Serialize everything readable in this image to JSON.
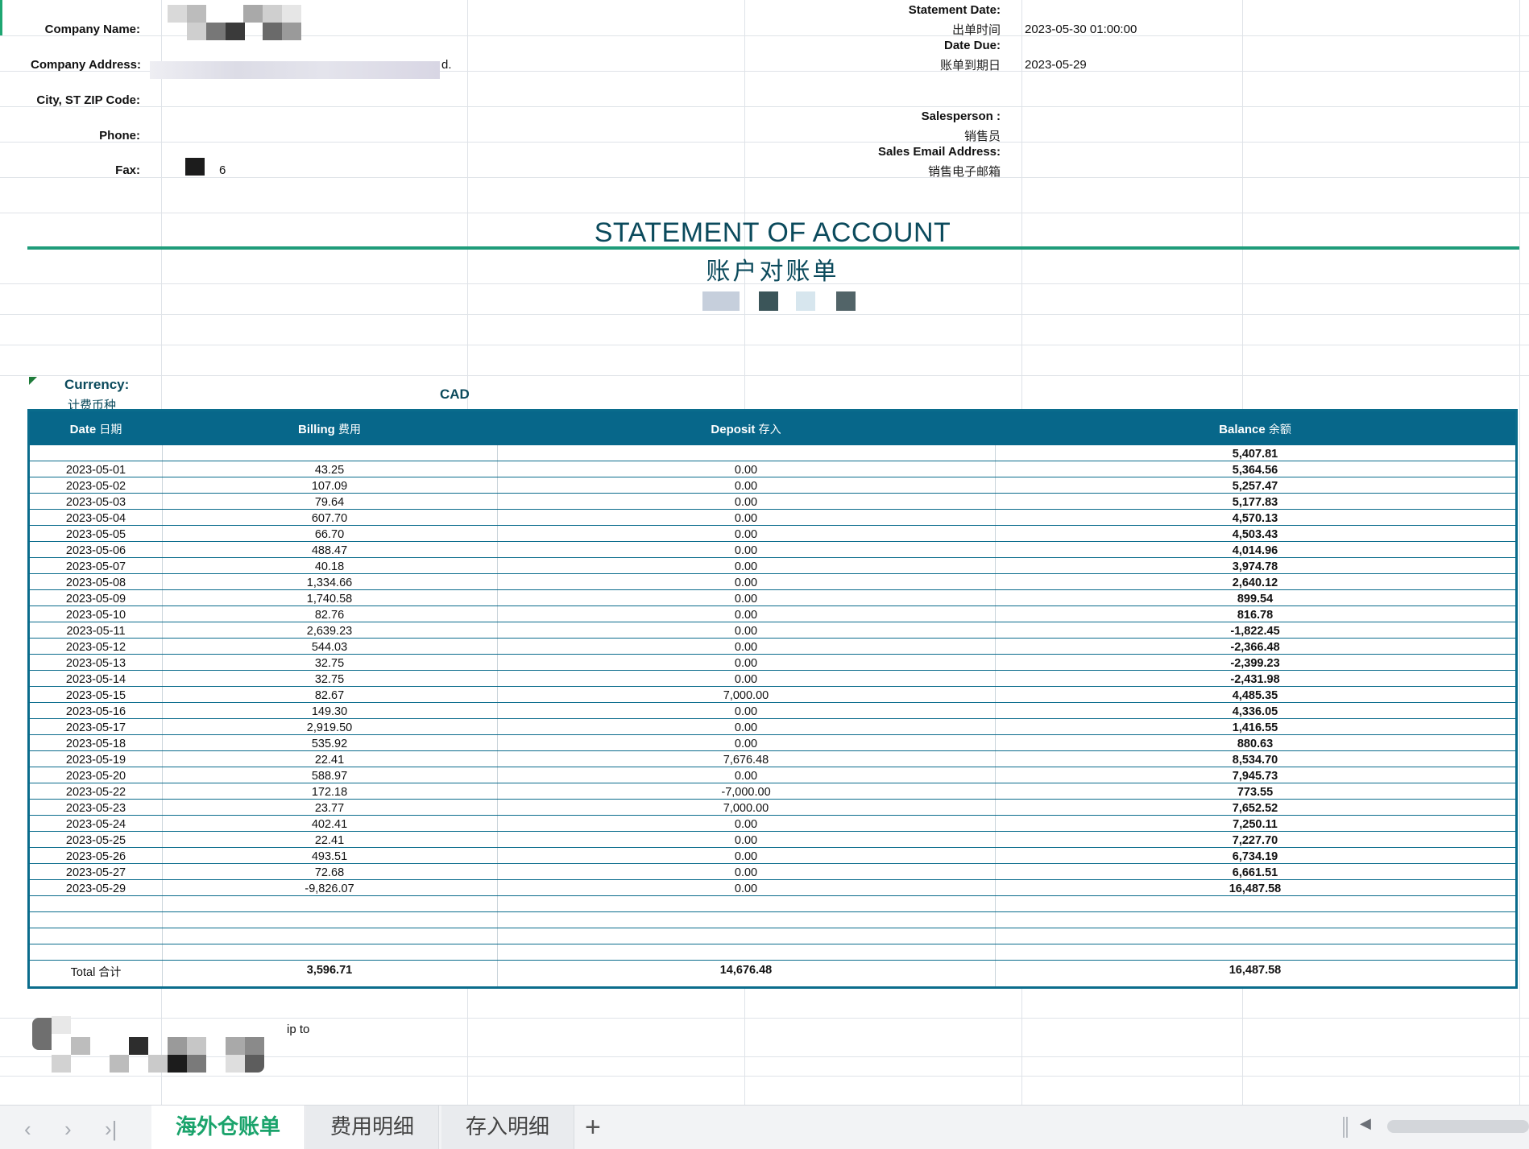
{
  "header_left": {
    "company_name_label": "Company Name:",
    "company_address_label": "Company Address:",
    "company_address_tail": "d.",
    "city_label": "City, ST  ZIP Code:",
    "phone_label": "Phone:",
    "fax_label": "Fax:",
    "fax_tail": "6"
  },
  "header_right": {
    "statement_date_label": "Statement Date:",
    "statement_date_cn": "出单时间",
    "statement_date_value": "2023-05-30 01:00:00",
    "date_due_label": "Date Due:",
    "date_due_cn": "账单到期日",
    "date_due_value": "2023-05-29",
    "salesperson_label": "Salesperson :",
    "salesperson_cn": "销售员",
    "sales_email_label": "Sales Email Address:",
    "sales_email_cn": "销售电子邮箱"
  },
  "title": {
    "en": "STATEMENT OF ACCOUNT",
    "cn": "账户对账单"
  },
  "currency": {
    "label": "Currency:",
    "cn": "计费币种",
    "value": "CAD"
  },
  "table": {
    "headers": {
      "date": "Date",
      "date_cn": "日期",
      "billing": "Billing",
      "billing_cn": "费用",
      "deposit": "Deposit",
      "deposit_cn": "存入",
      "balance": "Balance",
      "balance_cn": "余额"
    },
    "opening_balance": "5,407.81",
    "rows": [
      {
        "date": "2023-05-01",
        "billing": "43.25",
        "deposit": "0.00",
        "balance": "5,364.56"
      },
      {
        "date": "2023-05-02",
        "billing": "107.09",
        "deposit": "0.00",
        "balance": "5,257.47"
      },
      {
        "date": "2023-05-03",
        "billing": "79.64",
        "deposit": "0.00",
        "balance": "5,177.83"
      },
      {
        "date": "2023-05-04",
        "billing": "607.70",
        "deposit": "0.00",
        "balance": "4,570.13"
      },
      {
        "date": "2023-05-05",
        "billing": "66.70",
        "deposit": "0.00",
        "balance": "4,503.43"
      },
      {
        "date": "2023-05-06",
        "billing": "488.47",
        "deposit": "0.00",
        "balance": "4,014.96"
      },
      {
        "date": "2023-05-07",
        "billing": "40.18",
        "deposit": "0.00",
        "balance": "3,974.78"
      },
      {
        "date": "2023-05-08",
        "billing": "1,334.66",
        "deposit": "0.00",
        "balance": "2,640.12"
      },
      {
        "date": "2023-05-09",
        "billing": "1,740.58",
        "deposit": "0.00",
        "balance": "899.54"
      },
      {
        "date": "2023-05-10",
        "billing": "82.76",
        "deposit": "0.00",
        "balance": "816.78"
      },
      {
        "date": "2023-05-11",
        "billing": "2,639.23",
        "deposit": "0.00",
        "balance": "-1,822.45"
      },
      {
        "date": "2023-05-12",
        "billing": "544.03",
        "deposit": "0.00",
        "balance": "-2,366.48"
      },
      {
        "date": "2023-05-13",
        "billing": "32.75",
        "deposit": "0.00",
        "balance": "-2,399.23"
      },
      {
        "date": "2023-05-14",
        "billing": "32.75",
        "deposit": "0.00",
        "balance": "-2,431.98"
      },
      {
        "date": "2023-05-15",
        "billing": "82.67",
        "deposit": "7,000.00",
        "balance": "4,485.35"
      },
      {
        "date": "2023-05-16",
        "billing": "149.30",
        "deposit": "0.00",
        "balance": "4,336.05"
      },
      {
        "date": "2023-05-17",
        "billing": "2,919.50",
        "deposit": "0.00",
        "balance": "1,416.55"
      },
      {
        "date": "2023-05-18",
        "billing": "535.92",
        "deposit": "0.00",
        "balance": "880.63"
      },
      {
        "date": "2023-05-19",
        "billing": "22.41",
        "deposit": "7,676.48",
        "balance": "8,534.70"
      },
      {
        "date": "2023-05-20",
        "billing": "588.97",
        "deposit": "0.00",
        "balance": "7,945.73"
      },
      {
        "date": "2023-05-22",
        "billing": "172.18",
        "deposit": "-7,000.00",
        "balance": "773.55"
      },
      {
        "date": "2023-05-23",
        "billing": "23.77",
        "deposit": "7,000.00",
        "balance": "7,652.52"
      },
      {
        "date": "2023-05-24",
        "billing": "402.41",
        "deposit": "0.00",
        "balance": "7,250.11"
      },
      {
        "date": "2023-05-25",
        "billing": "22.41",
        "deposit": "0.00",
        "balance": "7,227.70"
      },
      {
        "date": "2023-05-26",
        "billing": "493.51",
        "deposit": "0.00",
        "balance": "6,734.19"
      },
      {
        "date": "2023-05-27",
        "billing": "72.68",
        "deposit": "0.00",
        "balance": "6,661.51"
      },
      {
        "date": "2023-05-29",
        "billing": "-9,826.07",
        "deposit": "0.00",
        "balance": "16,487.58"
      }
    ],
    "total": {
      "label": "Total",
      "label_cn": "合计",
      "billing": "3,596.71",
      "deposit": "14,676.48",
      "balance": "16,487.58"
    }
  },
  "footer_note": "ip to",
  "tabs": [
    {
      "label": "海外仓账单",
      "active": true
    },
    {
      "label": "费用明细",
      "active": false
    },
    {
      "label": "存入明细",
      "active": false
    }
  ],
  "nav": {
    "prev": "‹",
    "next": "›",
    "last": "›|",
    "add": "+",
    "scroll_left": "◀"
  },
  "colors": {
    "header_bg": "#07678a",
    "title_text": "#0b4a5c",
    "accent_rule": "#1f9c7a",
    "active_tab": "#1aa36b"
  }
}
